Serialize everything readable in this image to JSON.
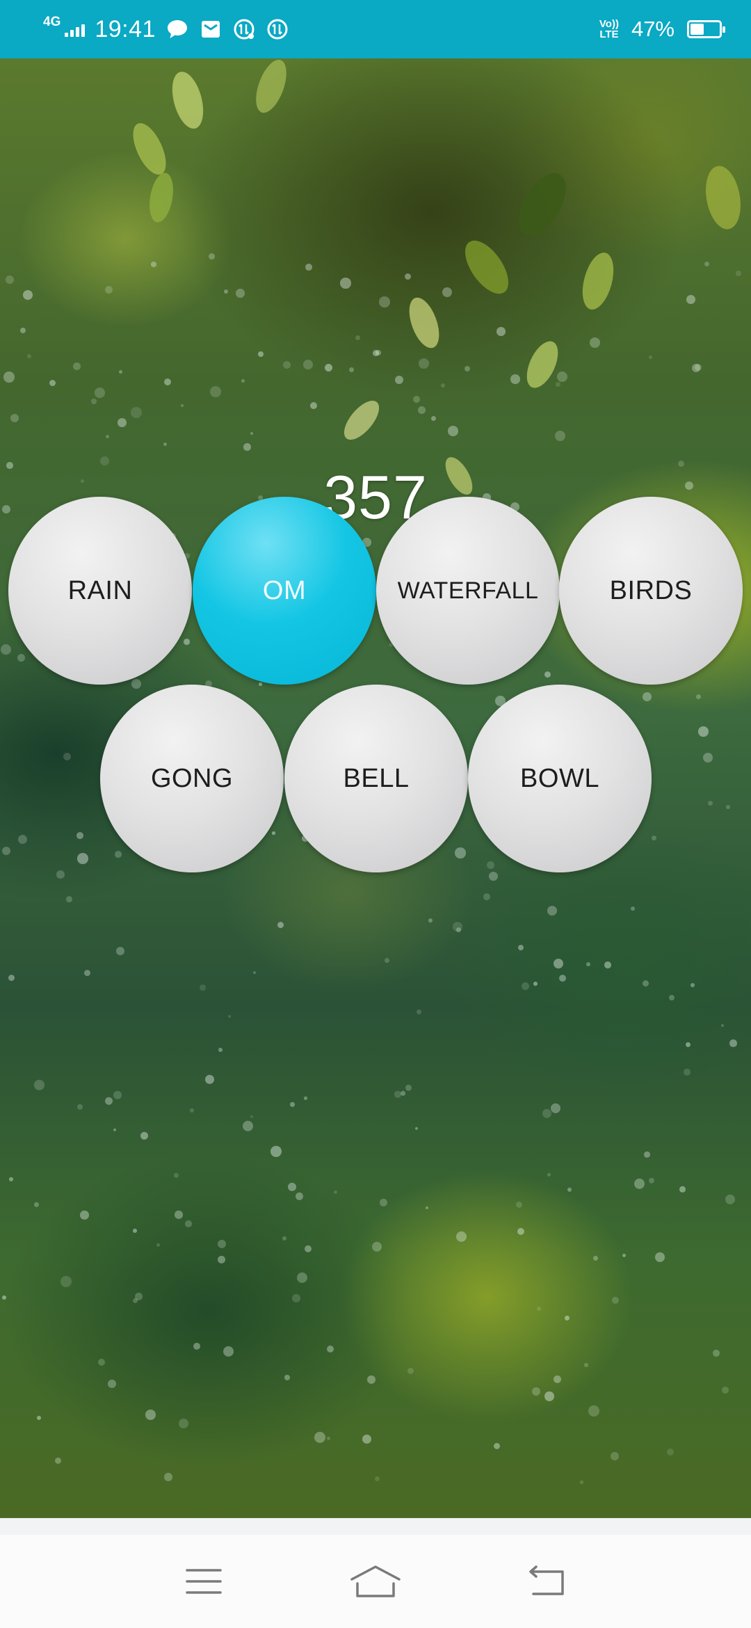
{
  "status_bar": {
    "network": "4G",
    "time": "19:41",
    "notification_icons": [
      "message-icon",
      "mail-icon",
      "data-saver-icon",
      "data-saver-alt-icon"
    ],
    "volte_top": "Vo))",
    "volte_bottom": "LTE",
    "battery_percent": "47%",
    "battery_level": 0.47
  },
  "main": {
    "counter": "357",
    "sounds_row1": [
      {
        "label": "RAIN",
        "active": false
      },
      {
        "label": "OM",
        "active": true
      },
      {
        "label": "WATERFALL",
        "active": false
      },
      {
        "label": "BIRDS",
        "active": false
      }
    ],
    "sounds_row2": [
      {
        "label": "GONG",
        "active": false
      },
      {
        "label": "BELL",
        "active": false
      },
      {
        "label": "BOWL",
        "active": false
      }
    ],
    "accent_color": "#0ABCDA"
  },
  "nav_bar": {
    "buttons": [
      "menu-icon",
      "home-icon",
      "back-icon"
    ]
  }
}
